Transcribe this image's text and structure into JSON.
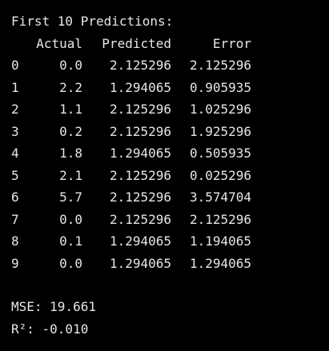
{
  "output": {
    "heading": "First 10 Predictions:",
    "columns": [
      "Actual",
      "Predicted",
      "Error"
    ],
    "rows": [
      {
        "index": "0",
        "actual": "0.0",
        "predicted": "2.125296",
        "error": "2.125296"
      },
      {
        "index": "1",
        "actual": "2.2",
        "predicted": "1.294065",
        "error": "0.905935"
      },
      {
        "index": "2",
        "actual": "1.1",
        "predicted": "2.125296",
        "error": "1.025296"
      },
      {
        "index": "3",
        "actual": "0.2",
        "predicted": "2.125296",
        "error": "1.925296"
      },
      {
        "index": "4",
        "actual": "1.8",
        "predicted": "1.294065",
        "error": "0.505935"
      },
      {
        "index": "5",
        "actual": "2.1",
        "predicted": "2.125296",
        "error": "0.025296"
      },
      {
        "index": "6",
        "actual": "5.7",
        "predicted": "2.125296",
        "error": "3.574704"
      },
      {
        "index": "7",
        "actual": "0.0",
        "predicted": "2.125296",
        "error": "2.125296"
      },
      {
        "index": "8",
        "actual": "0.1",
        "predicted": "1.294065",
        "error": "1.194065"
      },
      {
        "index": "9",
        "actual": "0.0",
        "predicted": "1.294065",
        "error": "1.294065"
      }
    ],
    "mse": "MSE: 19.661",
    "r2": "R²: -0.010"
  },
  "colors": {
    "background": "#000000",
    "text": "#e6e6e6"
  }
}
